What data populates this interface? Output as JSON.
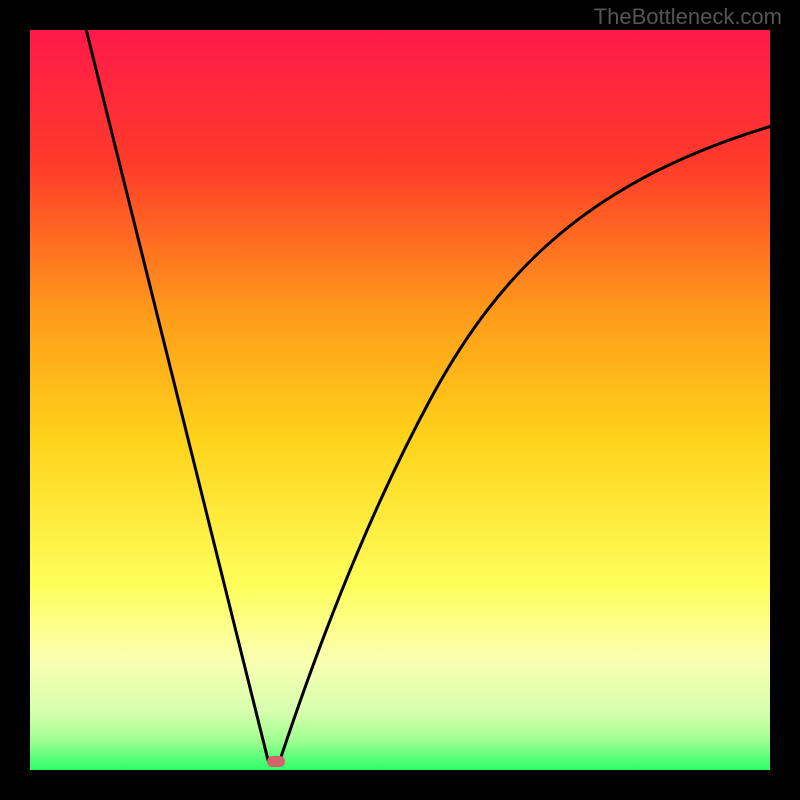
{
  "watermark": "TheBottleneck.com",
  "chart_data": {
    "type": "line",
    "title": "",
    "xlabel": "",
    "ylabel": "",
    "xlim": [
      0,
      100
    ],
    "ylim": [
      0,
      100
    ],
    "grid": false,
    "legend": false,
    "background_gradient": {
      "top": "#ff1a4a",
      "upper_mid": "#ff7a1a",
      "mid": "#ffd21a",
      "lower_mid": "#ffff7a",
      "lower": "#eaff9a",
      "bottom": "#2bff6a"
    },
    "curve": {
      "description": "V-shaped bottleneck curve; minimum near x≈33, rising steeply on both sides",
      "min_x": 33,
      "min_y": 0,
      "left_branch_top_x": 8,
      "left_branch_top_y": 100,
      "right_branch_end_x": 100,
      "right_branch_end_y": 85
    },
    "marker": {
      "x": 33,
      "y": 0.5,
      "color": "#d4626a",
      "shape": "rounded-rect"
    }
  }
}
